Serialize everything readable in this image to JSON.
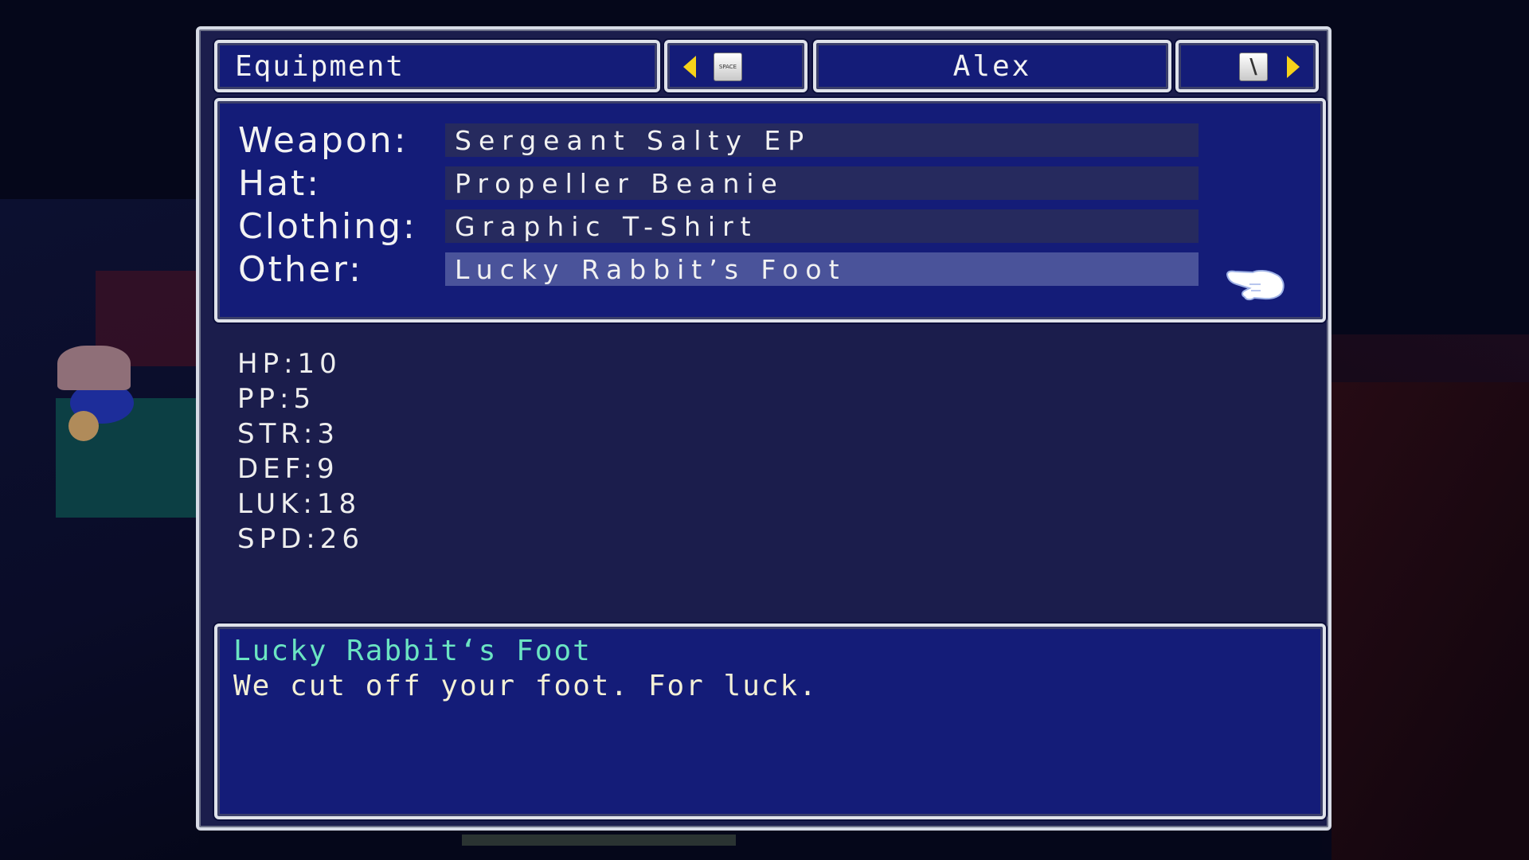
{
  "header": {
    "title": "Equipment",
    "prev_key": "SPACE",
    "character_name": "Alex",
    "next_key": "\\"
  },
  "equipment": {
    "slots": [
      {
        "label": "Weapon:",
        "value": "Sergeant Salty EP"
      },
      {
        "label": "Hat:",
        "value": "Propeller Beanie"
      },
      {
        "label": "Clothing:",
        "value": "Graphic T-Shirt"
      },
      {
        "label": "Other:",
        "value": "Lucky Rabbit’s Foot"
      }
    ],
    "selected_index": 3,
    "cursor_icon": "pointing-hand-icon"
  },
  "stats": [
    "HP:10",
    "PP:5",
    "STR:3",
    "DEF:9",
    "LUK:18",
    "SPD:26"
  ],
  "description": {
    "item_name": "Lucky Rabbit‘s Foot",
    "text": "We cut off your foot. For luck."
  },
  "colors": {
    "window_bg": "#141c78",
    "panel_bg": "#1b1d4c",
    "selected_row": "#4a539a",
    "item_name": "#6be4c2",
    "arrow": "#f6d21a"
  }
}
